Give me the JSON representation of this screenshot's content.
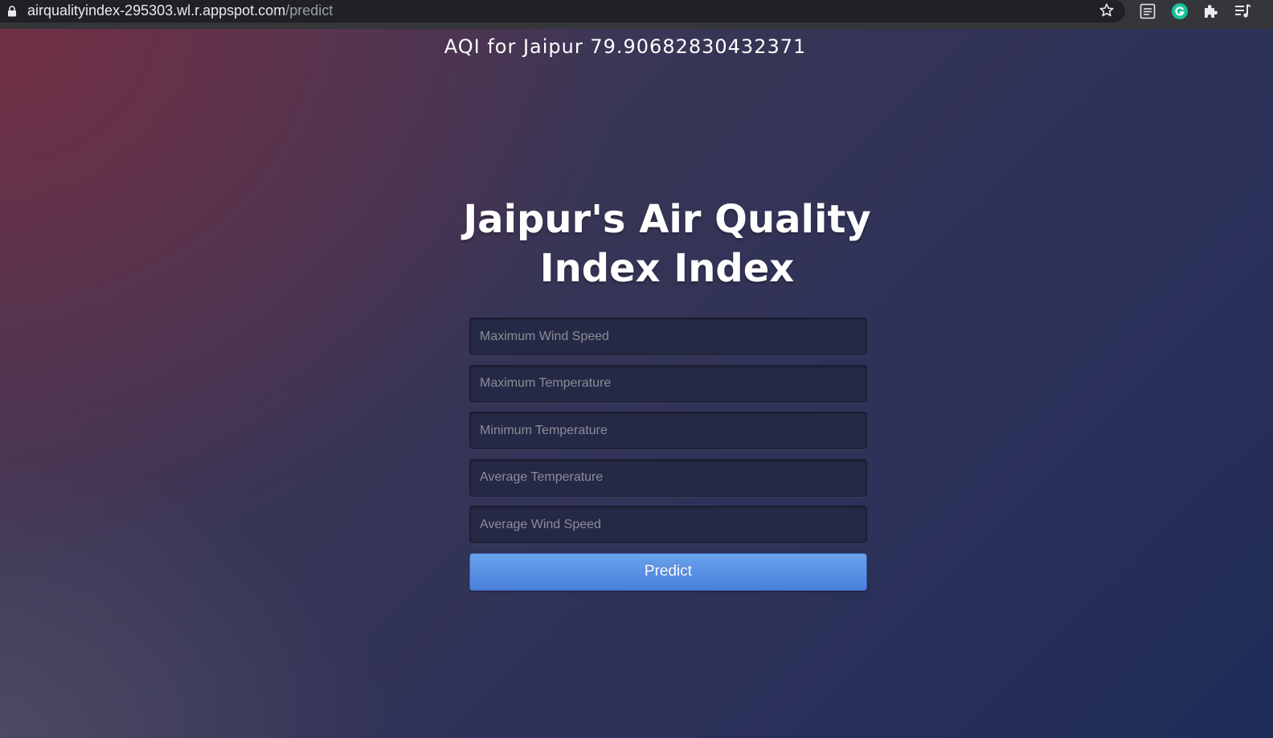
{
  "browser": {
    "url_domain": "airqualityindex-295303.wl.r.appspot.com",
    "url_path": "/predict",
    "icons": [
      "lock-icon",
      "star-icon",
      "reading-list-icon",
      "grammarly-icon",
      "extensions-icon",
      "media-control-icon"
    ],
    "colors": {
      "toolbar": "#35363a",
      "omnibox": "#202124",
      "grammarly": "#15c39a"
    }
  },
  "result": {
    "text": "AQI for Jaipur 79.90682830432371"
  },
  "header": {
    "title": "Jaipur's Air Quality Index Index"
  },
  "form": {
    "fields": [
      {
        "placeholder": "Maximum Wind Speed",
        "value": ""
      },
      {
        "placeholder": "Maximum Temperature",
        "value": ""
      },
      {
        "placeholder": "Minimum Temperature",
        "value": ""
      },
      {
        "placeholder": "Average Temperature",
        "value": ""
      },
      {
        "placeholder": "Average Wind Speed",
        "value": ""
      }
    ],
    "submit_label": "Predict"
  },
  "colors": {
    "button_top": "#6aa2ec",
    "button_bottom": "#4a7fdc",
    "field_background": "#252945",
    "text": "#ffffff"
  }
}
